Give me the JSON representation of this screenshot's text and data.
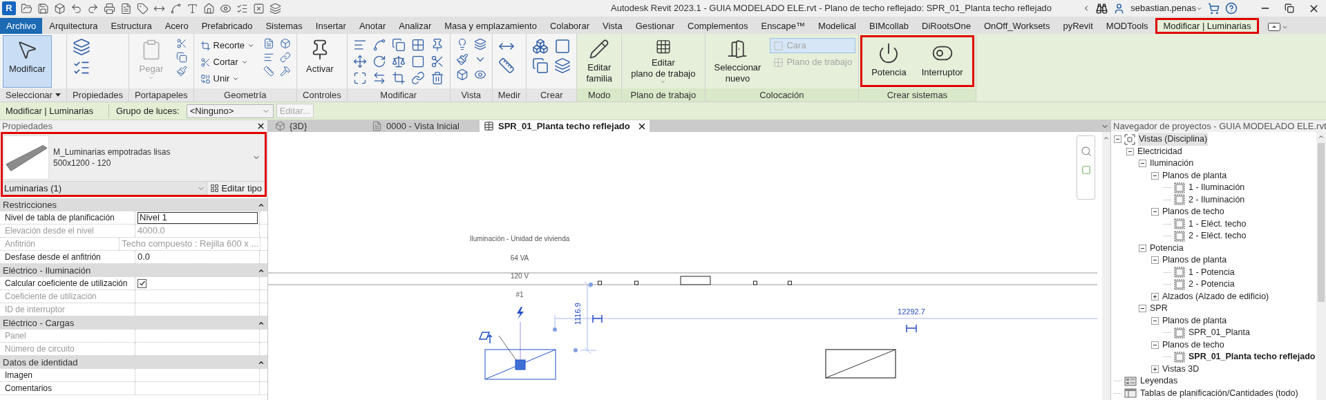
{
  "window": {
    "app_logo": "R",
    "title": "Autodesk Revit 2023.1 - GUIA MODELADO ELE.rvt - Plano de techo reflejado: SPR_01_Planta techo reflejado",
    "user": "sebastian.penas"
  },
  "ribbon_tabs": [
    {
      "label": "Archivo",
      "kind": "file",
      "selected": false
    },
    {
      "label": "Arquitectura",
      "kind": "normal",
      "selected": false
    },
    {
      "label": "Estructura",
      "kind": "normal",
      "selected": false
    },
    {
      "label": "Acero",
      "kind": "normal",
      "selected": false
    },
    {
      "label": "Prefabricado",
      "kind": "normal",
      "selected": false
    },
    {
      "label": "Sistemas",
      "kind": "normal",
      "selected": false
    },
    {
      "label": "Insertar",
      "kind": "normal",
      "selected": false
    },
    {
      "label": "Anotar",
      "kind": "normal",
      "selected": false
    },
    {
      "label": "Analizar",
      "kind": "normal",
      "selected": false
    },
    {
      "label": "Masa y emplazamiento",
      "kind": "normal",
      "selected": false
    },
    {
      "label": "Colaborar",
      "kind": "normal",
      "selected": false
    },
    {
      "label": "Vista",
      "kind": "normal",
      "selected": false
    },
    {
      "label": "Gestionar",
      "kind": "normal",
      "selected": false
    },
    {
      "label": "Complementos",
      "kind": "normal",
      "selected": false
    },
    {
      "label": "Enscape™",
      "kind": "normal",
      "selected": false
    },
    {
      "label": "Modelical",
      "kind": "normal",
      "selected": false
    },
    {
      "label": "BIMcollab",
      "kind": "normal",
      "selected": false
    },
    {
      "label": "DiRootsOne",
      "kind": "normal",
      "selected": false
    },
    {
      "label": "OnOff_Worksets",
      "kind": "normal",
      "selected": false
    },
    {
      "label": "pyRevit",
      "kind": "normal",
      "selected": false
    },
    {
      "label": "MODTools",
      "kind": "normal",
      "selected": false
    },
    {
      "label": "Modificar | Luminarias",
      "kind": "contextual",
      "selected": true
    }
  ],
  "ribbon_panels": [
    {
      "title": "Seleccionar",
      "menu": true,
      "contextual": false,
      "highlighted": false,
      "items": [
        {
          "label": [
            "Modificar"
          ],
          "kind": "large",
          "active": true,
          "disabled": false,
          "dropdown": false
        }
      ]
    },
    {
      "title": "Propiedades",
      "menu": false,
      "contextual": false,
      "highlighted": false
    },
    {
      "title": "Portapapeles",
      "menu": false,
      "contextual": false,
      "highlighted": false,
      "items": [
        {
          "label": [
            "Pegar"
          ],
          "kind": "large",
          "active": false,
          "disabled": true,
          "dropdown": true
        }
      ]
    },
    {
      "title": "Geometría",
      "menu": false,
      "contextual": false,
      "highlighted": false,
      "items": [
        {
          "label": [
            "Recorte"
          ],
          "kind": "small",
          "active": false,
          "disabled": false,
          "dropdown": true
        },
        {
          "label": [
            "Cortar"
          ],
          "kind": "small",
          "active": false,
          "disabled": false,
          "dropdown": true
        },
        {
          "label": [
            "Unir"
          ],
          "kind": "small",
          "active": false,
          "disabled": false,
          "dropdown": true
        }
      ]
    },
    {
      "title": "Controles",
      "menu": false,
      "contextual": false,
      "highlighted": false,
      "items": [
        {
          "label": [
            "Activar"
          ],
          "kind": "large",
          "active": false,
          "disabled": false,
          "dropdown": false
        }
      ]
    },
    {
      "title": "Modificar",
      "menu": false,
      "contextual": false,
      "highlighted": false
    },
    {
      "title": "Vista",
      "menu": false,
      "contextual": false,
      "highlighted": false
    },
    {
      "title": "Medir",
      "menu": false,
      "contextual": false,
      "highlighted": false
    },
    {
      "title": "Crear",
      "menu": false,
      "contextual": false,
      "highlighted": false
    },
    {
      "title": "Modo",
      "menu": false,
      "contextual": true,
      "highlighted": false,
      "items": [
        {
          "label": [
            "Editar",
            "familia"
          ],
          "kind": "large",
          "active": false,
          "disabled": false,
          "dropdown": false
        }
      ]
    },
    {
      "title": "Plano de trabajo",
      "menu": false,
      "contextual": true,
      "highlighted": false,
      "items": [
        {
          "label": [
            "Editar",
            "plano de trabajo"
          ],
          "kind": "large",
          "active": false,
          "disabled": false,
          "dropdown": true
        }
      ]
    },
    {
      "title": "Colocación",
      "menu": false,
      "contextual": true,
      "highlighted": false,
      "items": [
        {
          "label": [
            "Seleccionar",
            "nuevo"
          ],
          "kind": "large",
          "active": false,
          "disabled": false,
          "dropdown": false
        },
        {
          "label": [
            "Cara"
          ],
          "kind": "small",
          "active": true,
          "disabled": true,
          "dropdown": false
        },
        {
          "label": [
            "Plano de trabajo"
          ],
          "kind": "small",
          "active": false,
          "disabled": true,
          "dropdown": false
        }
      ]
    },
    {
      "title": "Crear sistemas",
      "menu": false,
      "contextual": true,
      "highlighted": true,
      "items": [
        {
          "label": [
            "Potencia"
          ],
          "kind": "large",
          "active": false,
          "disabled": false,
          "dropdown": false
        },
        {
          "label": [
            "Interruptor"
          ],
          "kind": "large",
          "active": false,
          "disabled": false,
          "dropdown": false
        }
      ]
    }
  ],
  "options_bar": {
    "label": "Modificar | Luminarias",
    "group_label": "Grupo de luces:",
    "group_value": "<Ninguno>",
    "edit_button": "Editar...",
    "edit_disabled": true
  },
  "properties": {
    "title": "Propiedades",
    "type_name": "M_Luminarias empotradas lisas",
    "type_size": "500x1200 - 120",
    "instance_filter": "Luminarias (1)",
    "edit_type": "Editar tipo",
    "highlighted": true,
    "groups": [
      {
        "title": "Restricciones",
        "rows": [
          {
            "label": "Nivel de tabla de planificación",
            "value": "Nivel 1",
            "kind": "field",
            "disabled": false
          },
          {
            "label": "Elevación desde el nivel",
            "value": "4000.0",
            "kind": "text",
            "disabled": true
          },
          {
            "label": "Anfitrión",
            "value": "Techo compuesto : Rejilla 600 x ...",
            "kind": "text",
            "disabled": true
          },
          {
            "label": "Desfase desde el anfitrión",
            "value": "0.0",
            "kind": "text",
            "disabled": false
          }
        ]
      },
      {
        "title": "Eléctrico - Iluminación",
        "rows": [
          {
            "label": "Calcular coeficiente de utilización",
            "kind": "checkbox",
            "checked": true,
            "disabled": false
          },
          {
            "label": "Coeficiente de utilización",
            "kind": "text",
            "disabled": true
          },
          {
            "label": "ID de interruptor",
            "kind": "text",
            "disabled": true
          }
        ]
      },
      {
        "title": "Eléctrico - Cargas",
        "rows": [
          {
            "label": "Panel",
            "kind": "text",
            "disabled": true
          },
          {
            "label": "Número de circuito",
            "kind": "text",
            "disabled": true
          }
        ]
      },
      {
        "title": "Datos de identidad",
        "rows": [
          {
            "label": "Imagen",
            "kind": "text",
            "disabled": false
          },
          {
            "label": "Comentarios",
            "kind": "text",
            "disabled": false
          }
        ]
      }
    ]
  },
  "view_tabs": [
    {
      "label": "{3D}",
      "kind": "model",
      "selected": false
    },
    {
      "label": "0000 - Vista Inicial",
      "kind": "sheet",
      "selected": false
    },
    {
      "label": "SPR_01_Planta techo reflejado",
      "kind": "ceiling",
      "selected": true
    }
  ],
  "canvas": {
    "circuit_tag": [
      "Iluminación - Unidad de vivienda",
      "64 VA",
      "120 V",
      "#1"
    ],
    "vertical_dimension": "1116.9",
    "horizontal_dimension": "12292.7"
  },
  "browser": {
    "title": "Navegador de proyectos - GUIA MODELADO ELE.rvt",
    "tree": [
      {
        "label": "Vistas (Disciplina)",
        "kind": "category",
        "expanded": true,
        "selected": true,
        "open": false,
        "children": [
          {
            "label": "Electricidad",
            "kind": "folder",
            "expanded": true,
            "selected": false,
            "open": false,
            "children": [
              {
                "label": "Iluminación",
                "kind": "folder",
                "expanded": true,
                "selected": false,
                "open": false,
                "children": [
                  {
                    "label": "Planos de planta",
                    "kind": "folder",
                    "expanded": true,
                    "selected": false,
                    "open": false,
                    "children": [
                      {
                        "label": "1 - Iluminación",
                        "kind": "view",
                        "selected": false,
                        "open": false
                      },
                      {
                        "label": "2 - Iluminación",
                        "kind": "view",
                        "selected": false,
                        "open": false
                      }
                    ]
                  },
                  {
                    "label": "Planos de techo",
                    "kind": "folder",
                    "expanded": true,
                    "selected": false,
                    "open": false,
                    "children": [
                      {
                        "label": "1 - Eléct. techo",
                        "kind": "view",
                        "selected": false,
                        "open": false
                      },
                      {
                        "label": "2 - Eléct. techo",
                        "kind": "view",
                        "selected": false,
                        "open": false
                      }
                    ]
                  }
                ]
              },
              {
                "label": "Potencia",
                "kind": "folder",
                "expanded": true,
                "selected": false,
                "open": false,
                "children": [
                  {
                    "label": "Planos de planta",
                    "kind": "folder",
                    "expanded": true,
                    "selected": false,
                    "open": false,
                    "children": [
                      {
                        "label": "1 - Potencia",
                        "kind": "view",
                        "selected": false,
                        "open": false
                      },
                      {
                        "label": "2 - Potencia",
                        "kind": "view",
                        "selected": false,
                        "open": false
                      }
                    ]
                  },
                  {
                    "label": "Alzados (Alzado de edificio)",
                    "kind": "folder",
                    "expanded": false,
                    "selected": false,
                    "open": false
                  }
                ]
              },
              {
                "label": "SPR",
                "kind": "folder",
                "expanded": true,
                "selected": false,
                "open": false,
                "children": [
                  {
                    "label": "Planos de planta",
                    "kind": "folder",
                    "expanded": true,
                    "selected": false,
                    "open": false,
                    "children": [
                      {
                        "label": "SPR_01_Planta",
                        "kind": "view",
                        "selected": false,
                        "open": false
                      }
                    ]
                  },
                  {
                    "label": "Planos de techo",
                    "kind": "folder",
                    "expanded": true,
                    "selected": false,
                    "open": false,
                    "children": [
                      {
                        "label": "SPR_01_Planta techo reflejado",
                        "kind": "view",
                        "selected": false,
                        "open": true
                      }
                    ]
                  },
                  {
                    "label": "Vistas 3D",
                    "kind": "folder",
                    "expanded": false,
                    "selected": false,
                    "open": false
                  }
                ]
              }
            ]
          }
        ]
      },
      {
        "label": "Leyendas",
        "kind": "legends",
        "selected": false,
        "open": false
      },
      {
        "label": "Tablas de planificación/Cantidades (todo)",
        "kind": "schedules",
        "selected": false,
        "open": false
      }
    ]
  }
}
